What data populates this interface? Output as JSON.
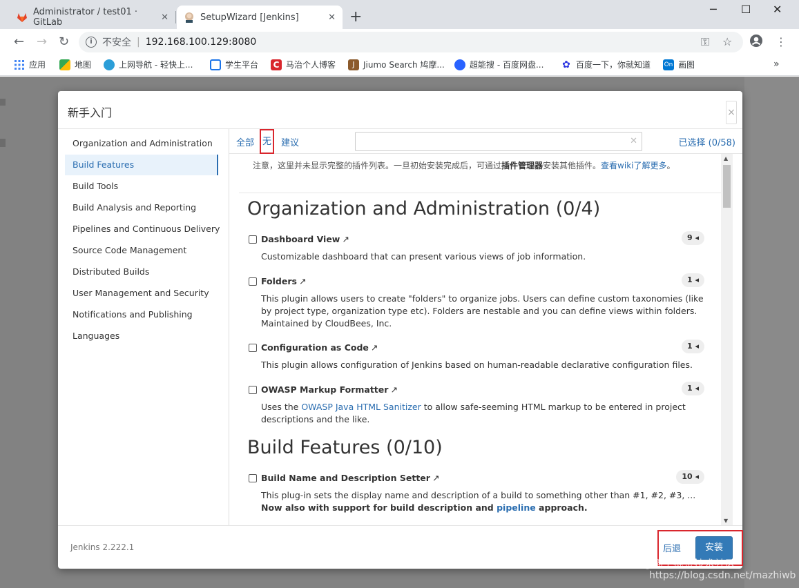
{
  "browser": {
    "tabs": [
      {
        "title": "Administrator / test01 · GitLab",
        "active": false
      },
      {
        "title": "SetupWizard [Jenkins]",
        "active": true
      }
    ],
    "address": {
      "security": "不安全",
      "url": "192.168.100.129:8080"
    },
    "bookmarks": [
      "应用",
      "地图",
      "上网导航 - 轻快上...",
      "学生平台",
      "马治个人博客",
      "Jiumo Search 鸠摩...",
      "超能搜 - 百度网盘...",
      "百度一下，你就知道",
      "画图"
    ],
    "colors": {
      "tabstrip": "#dee1e6",
      "gitlab": "#e24329",
      "bookmark_red": "#d9262d"
    }
  },
  "modal": {
    "title": "新手入门",
    "close": "×",
    "sidebar": {
      "active_index": 1,
      "items": [
        "Organization and Administration",
        "Build Features",
        "Build Tools",
        "Build Analysis and Reporting",
        "Pipelines and Continuous Delivery",
        "Source Code Management",
        "Distributed Builds",
        "User Management and Security",
        "Notifications and Publishing",
        "Languages"
      ]
    },
    "filter": {
      "all": "全部",
      "none": "无",
      "suggested": "建议",
      "search_value": "",
      "selected": "已选择 (0/58)"
    },
    "notice": {
      "prefix": "注意，这里并未显示完整的插件列表。一旦初始安装完成后，可通过",
      "bold": "插件管理器",
      "middle": "安装其他插件。",
      "link": "查看wiki了解更多",
      "suffix": "。"
    },
    "categories": [
      {
        "title": "Organization and Administration (0/4)",
        "plugins": [
          {
            "name": "Dashboard View",
            "badge": "9",
            "desc": "Customizable dashboard that can present various views of job information."
          },
          {
            "name": "Folders",
            "badge": "1",
            "desc": "This plugin allows users to create \"folders\" to organize jobs. Users can define custom taxonomies (like by project type, organization type etc). Folders are nestable and you can define views within folders. Maintained by CloudBees, Inc."
          },
          {
            "name": "Configuration as Code",
            "badge": "1",
            "desc": "This plugin allows configuration of Jenkins based on human-readable declarative configuration files."
          },
          {
            "name": "OWASP Markup Formatter",
            "badge": "1",
            "desc_prefix": "Uses the ",
            "desc_link": "OWASP Java HTML Sanitizer",
            "desc_suffix": " to allow safe-seeming HTML markup to be entered in project descriptions and the like."
          }
        ]
      },
      {
        "title": "Build Features (0/10)",
        "plugins": [
          {
            "name": "Build Name and Description Setter",
            "badge": "10",
            "desc": "This plug-in sets the display name and description of a build to something other than #1, #2, #3, ...",
            "desc_bold_prefix": "Now also with support for build description and ",
            "desc_bold_link": "pipeline",
            "desc_bold_suffix": " approach."
          }
        ]
      }
    ],
    "footer": {
      "version": "Jenkins 2.222.1",
      "back": "后退",
      "install": "安装"
    },
    "colors": {
      "accent": "#337ab7",
      "link": "#2a6db0",
      "highlight_box": "#d9262d",
      "active_bg": "#e8f2fb"
    }
  },
  "watermark": {
    "line1": "@稀土掘金技术社区",
    "line2": "https://blog.csdn.net/mazhiwb"
  }
}
